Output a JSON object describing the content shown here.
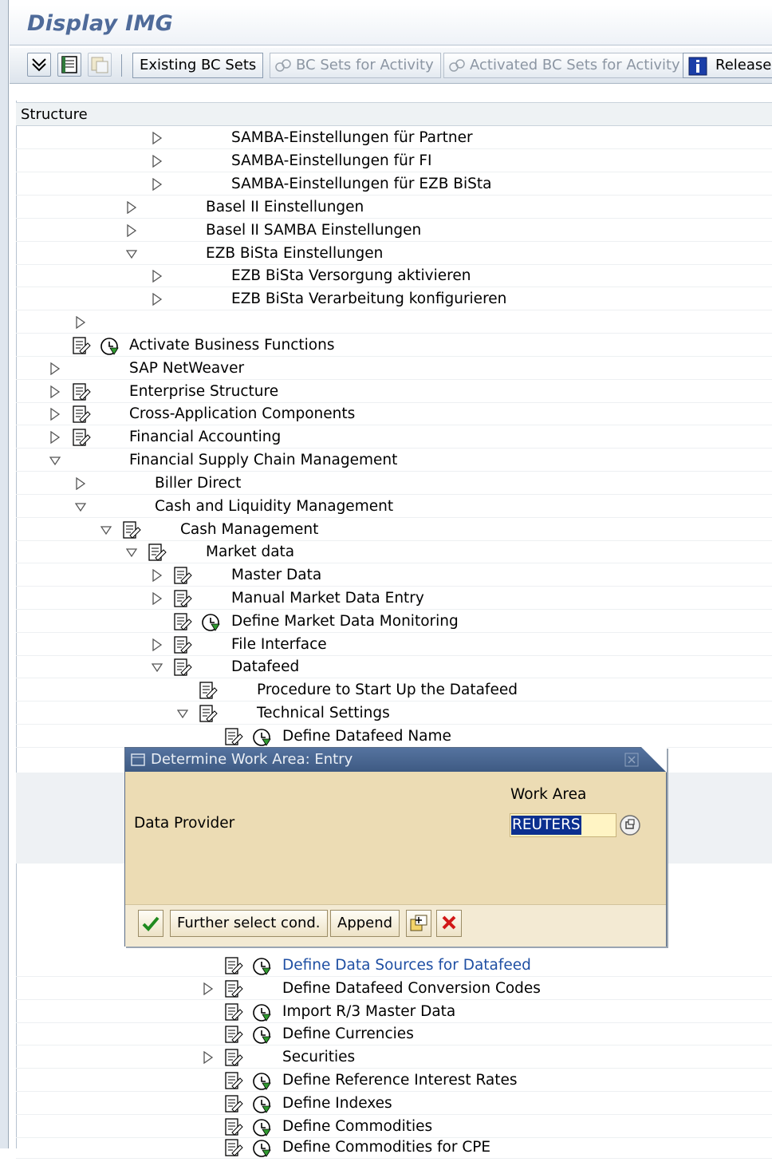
{
  "window": {
    "title": "Display IMG"
  },
  "toolbar": {
    "existing_bc_sets": "Existing BC Sets",
    "bc_sets_for_activity": "BC Sets for Activity",
    "activated_bc_sets": "Activated BC Sets for Activity",
    "release": "Release"
  },
  "structure": {
    "header": "Structure",
    "rows": [
      {
        "label": "SAMBA-Einstellungen für Partner"
      },
      {
        "label": "SAMBA-Einstellungen für FI"
      },
      {
        "label": "SAMBA-Einstellungen für EZB BiSta"
      },
      {
        "label": "Basel II Einstellungen"
      },
      {
        "label": "Basel II SAMBA Einstellungen"
      },
      {
        "label": "EZB BiSta Einstellungen"
      },
      {
        "label": "EZB BiSta Versorgung aktivieren"
      },
      {
        "label": "EZB BiSta Verarbeitung konfigurieren"
      },
      {
        "label": ""
      },
      {
        "label": "Activate Business Functions"
      },
      {
        "label": "SAP NetWeaver"
      },
      {
        "label": "Enterprise Structure"
      },
      {
        "label": "Cross-Application Components"
      },
      {
        "label": "Financial Accounting"
      },
      {
        "label": "Financial Supply Chain Management"
      },
      {
        "label": "Biller Direct"
      },
      {
        "label": "Cash and Liquidity Management"
      },
      {
        "label": "Cash Management"
      },
      {
        "label": "Market data"
      },
      {
        "label": "Master Data"
      },
      {
        "label": "Manual Market Data Entry"
      },
      {
        "label": "Define Market Data Monitoring"
      },
      {
        "label": "File Interface"
      },
      {
        "label": "Datafeed"
      },
      {
        "label": "Procedure to Start Up the Datafeed"
      },
      {
        "label": "Technical Settings"
      },
      {
        "label": "Define Datafeed Name"
      },
      {
        "label": "Define Data Sources for Datafeed"
      },
      {
        "label": "Define Datafeed Conversion Codes"
      },
      {
        "label": "Import R/3 Master Data"
      },
      {
        "label": "Define Currencies"
      },
      {
        "label": "Securities"
      },
      {
        "label": "Define Reference Interest Rates"
      },
      {
        "label": "Define Indexes"
      },
      {
        "label": "Define Commodities"
      },
      {
        "label": "Define Commodities for CPE"
      }
    ]
  },
  "dialog": {
    "title": "Determine Work Area: Entry",
    "column_header": "Work Area",
    "field_label": "Data Provider",
    "field_value": "REUTERS",
    "buttons": {
      "further": "Further select cond.",
      "append": "Append"
    }
  },
  "colors": {
    "accent": "#3e5a83",
    "dialog_bg": "#ecdcb4",
    "title": "#4f6b9a"
  }
}
